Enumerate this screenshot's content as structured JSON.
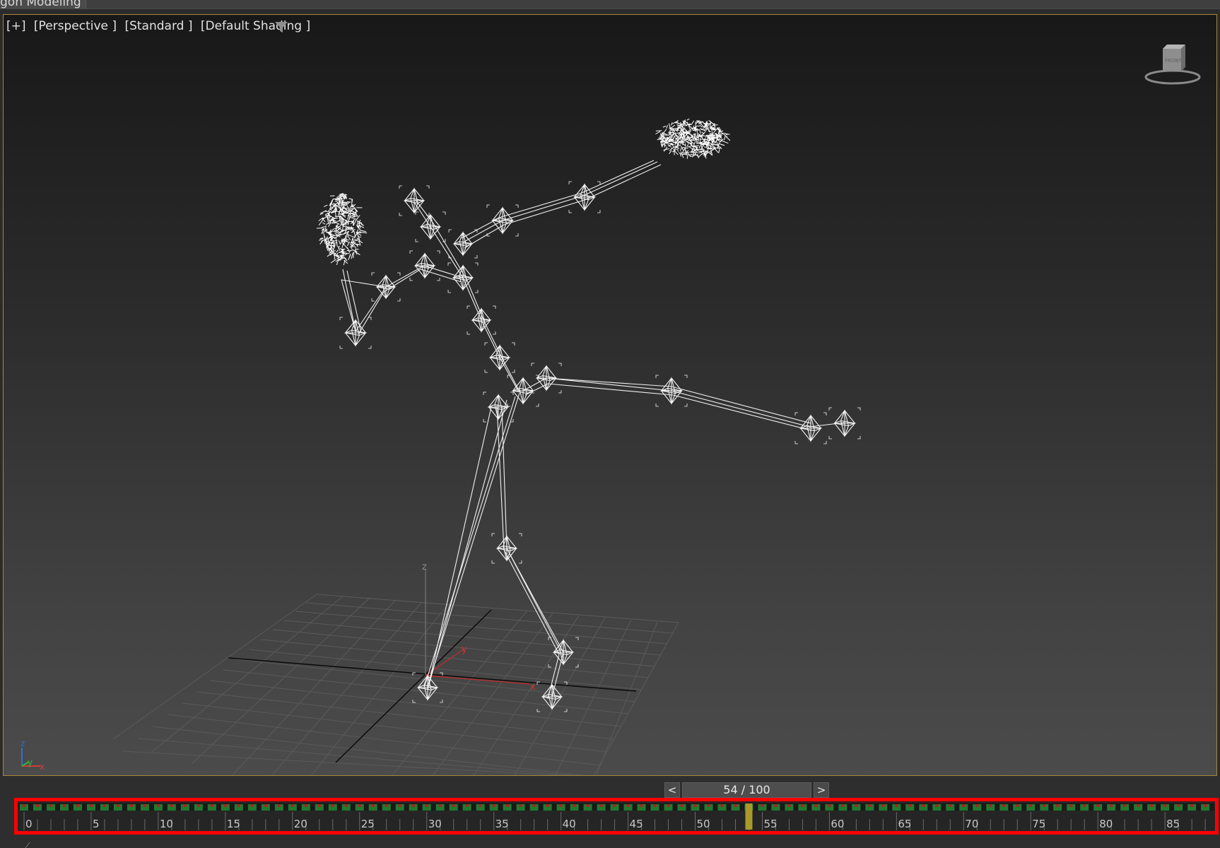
{
  "ribbon": {
    "active_tab": "gon Modeling"
  },
  "viewport": {
    "labels": [
      "[+]",
      "[Perspective ]",
      "[Standard ]",
      "[Default Shading ]"
    ],
    "filter_icon": "filter-funnel-icon",
    "viewcube_icon": "viewcube-icon",
    "viewcube_face_label": "FRONT",
    "axis_tripod_labels": {
      "z": "z",
      "y": "y",
      "x": "x"
    },
    "grid_axis_labels": {
      "z": "z",
      "y": "y",
      "x": "x"
    }
  },
  "timeline": {
    "prev_label": "<",
    "next_label": ">",
    "frame_counter": "54 / 100",
    "current_frame": 54,
    "total_frames": 100,
    "tick_labels": [
      "0",
      "5",
      "10",
      "15",
      "20",
      "25",
      "30",
      "35",
      "40",
      "45",
      "50",
      "55",
      "60",
      "65",
      "70",
      "75",
      "80",
      "85"
    ],
    "highlight_color": "#ff0000",
    "key_color": "#1f7a2f",
    "time_slider_color": "#a89a2a"
  }
}
